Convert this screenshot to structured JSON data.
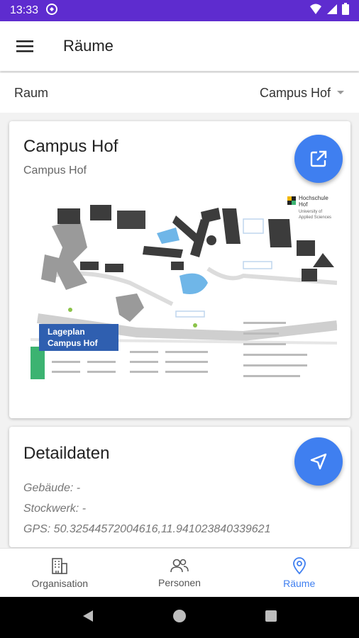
{
  "status": {
    "time": "13:33"
  },
  "appbar": {
    "title": "Räume"
  },
  "room_select": {
    "label": "Raum",
    "value": "Campus Hof"
  },
  "location_card": {
    "title": "Campus Hof",
    "subtitle": "Campus Hof",
    "map": {
      "heading_line1": "Lageplan",
      "heading_line2": "Campus Hof",
      "logo_line1": "Hochschule",
      "logo_line2": "Hof",
      "logo_line3": "University of",
      "logo_line4": "Applied Sciences"
    }
  },
  "details_card": {
    "title": "Detaildaten",
    "building": "Gebäude: -",
    "floor": "Stockwerk: -",
    "gps": "GPS: 50.32544572004616,11.941023840339621"
  },
  "bottom_nav": [
    {
      "label": "Organisation",
      "icon": "building-icon"
    },
    {
      "label": "Personen",
      "icon": "people-icon"
    },
    {
      "label": "Räume",
      "icon": "location-pin-icon",
      "active": true
    }
  ],
  "colors": {
    "accent": "#3f7ff0",
    "statusbar": "#5e2ccf",
    "map_label": "#2f5fb0",
    "map_green": "#3cb371"
  }
}
